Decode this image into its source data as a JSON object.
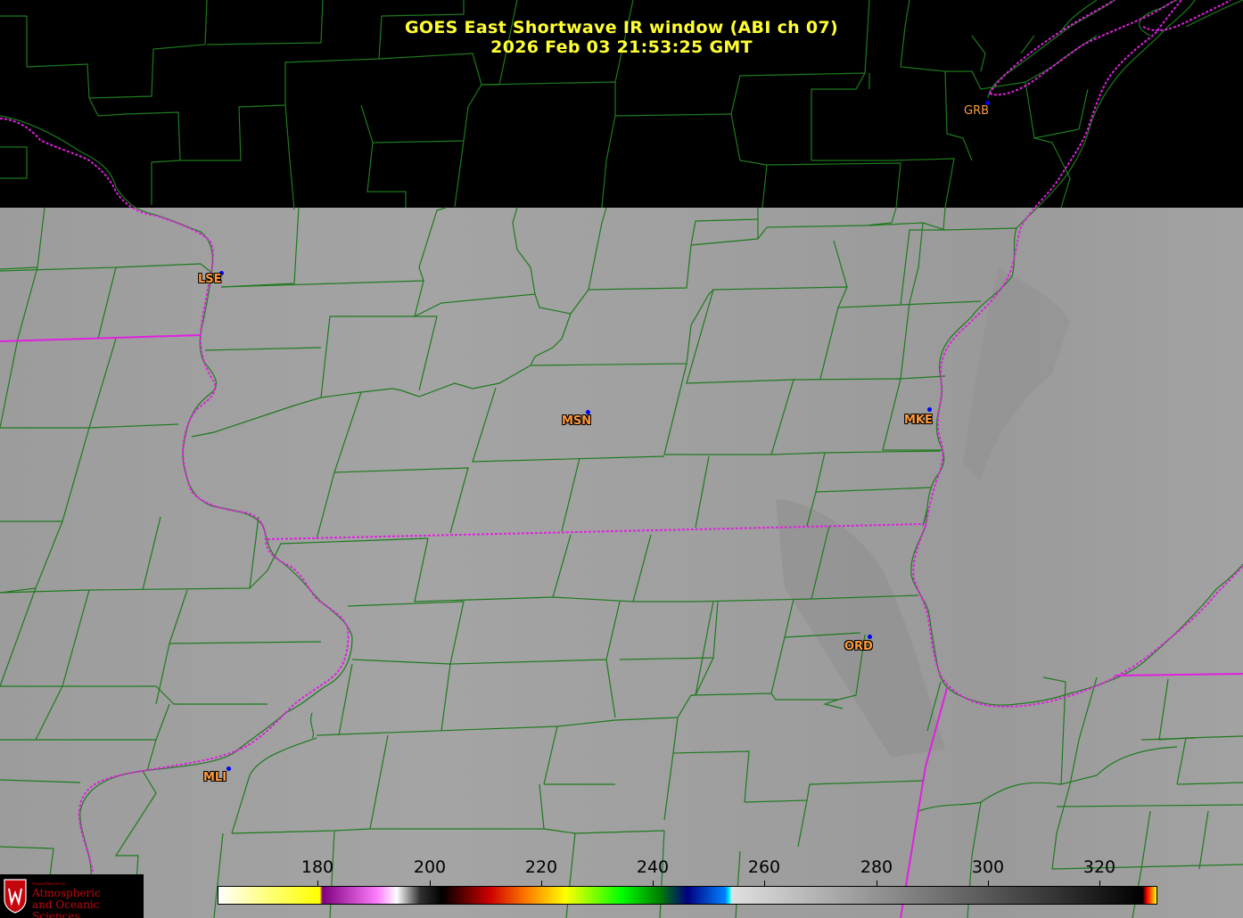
{
  "title": {
    "line1": "GOES East Shortwave IR window (ABI ch 07)",
    "line2": "2026 Feb 03  21:53:25 GMT"
  },
  "cities": [
    {
      "id": "GRB",
      "label": "GRB"
    },
    {
      "id": "LSE",
      "label": "LSE"
    },
    {
      "id": "MSN",
      "label": "MSN"
    },
    {
      "id": "MKE",
      "label": "MKE"
    },
    {
      "id": "ORD",
      "label": "ORD"
    },
    {
      "id": "MLI",
      "label": "MLI"
    }
  ],
  "colorbar": {
    "ticks": [
      "180",
      "200",
      "220",
      "240",
      "260",
      "280",
      "300",
      "320"
    ]
  },
  "logo": {
    "dept": "Department of",
    "line1": "Atmospheric",
    "line2": "and Oceanic Sciences"
  },
  "colors": {
    "county_lines": "#1e7a1e",
    "state_lines": "#e020e0",
    "title": "#ffff33",
    "city_label": "#ff9a3c",
    "city_dot": "#0000ff",
    "background_dark": "#000000",
    "cloud_gray": "#a8a8a8"
  }
}
